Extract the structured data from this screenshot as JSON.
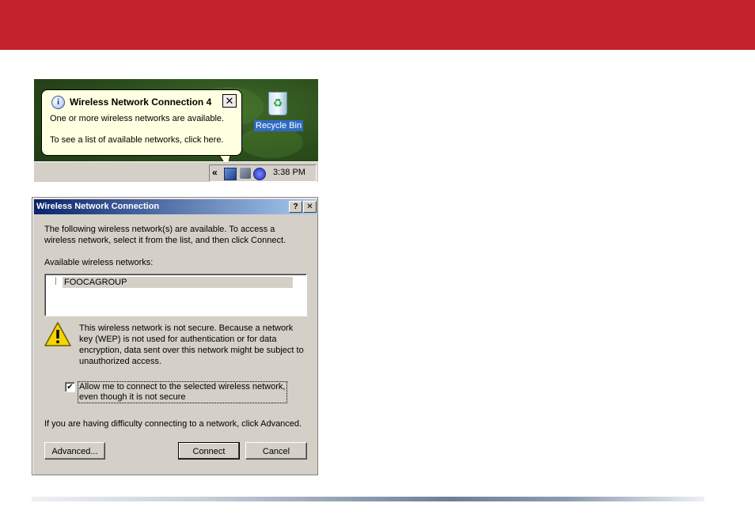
{
  "notification": {
    "title": "Wireless Network Connection 4",
    "message_line1": "One or more wireless networks are available.",
    "message_line2": "To see a list of available networks, click here.",
    "close_glyph": "✕",
    "info_glyph": "i"
  },
  "desktop": {
    "recycle_bin_label": "Recycle Bin"
  },
  "taskbar": {
    "chevron": "«",
    "clock": "3:38 PM"
  },
  "dialog": {
    "title": "Wireless Network Connection",
    "help_glyph": "?",
    "close_glyph": "✕",
    "intro_line1": "The following wireless network(s) are available. To access a",
    "intro_line2": "wireless network, select it from the list, and then click Connect.",
    "networks_label": "Available wireless networks:",
    "networks": [
      "FOOCAGROUP"
    ],
    "warning_line1": "This wireless network is not secure. Because a network",
    "warning_line2": "key (WEP) is not used for authentication or for data",
    "warning_line3": "encryption, data sent over this network might be subject to",
    "warning_line4": "unauthorized access.",
    "allow_checked": true,
    "allow_line1": "Allow me to connect to the selected wireless network,",
    "allow_line2": "even though it is not secure",
    "difficulty_text": "If you are having difficulty connecting to a network, click Advanced.",
    "advanced_label": "Advanced...",
    "connect_label": "Connect",
    "cancel_label": "Cancel",
    "check_glyph": "✔"
  },
  "colors": {
    "brand_red": "#c4222c",
    "title_bar_start": "#0a246a",
    "title_bar_end": "#a6caf0",
    "dialog_face": "#d4d0c8",
    "balloon_bg": "#ffffe1"
  }
}
